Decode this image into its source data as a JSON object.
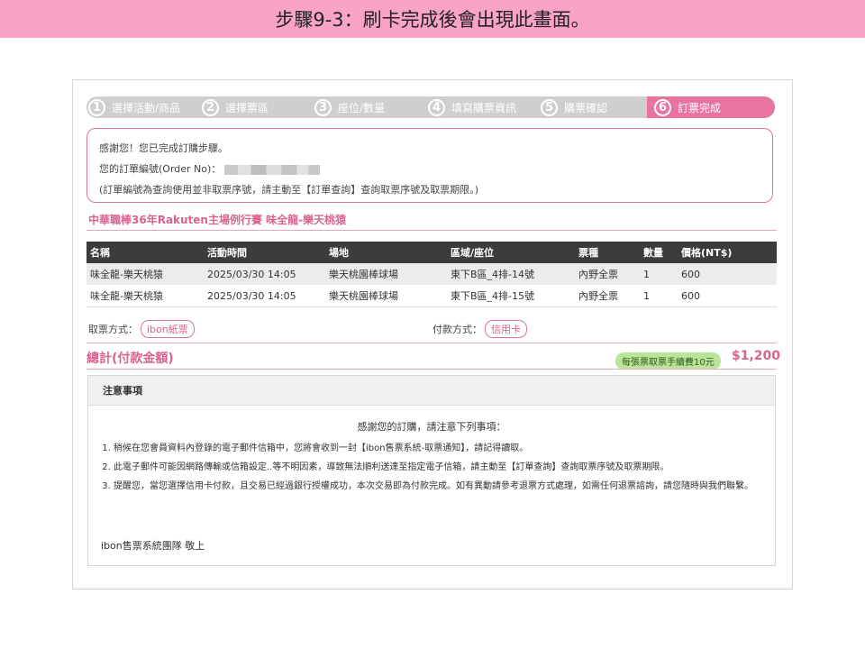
{
  "banner": {
    "title": "步驟9-3：刷卡完成後會出現此畫面。"
  },
  "steps": [
    {
      "num": "1",
      "label": "選擇活動/商品"
    },
    {
      "num": "2",
      "label": "選擇票區"
    },
    {
      "num": "3",
      "label": "座位/數量"
    },
    {
      "num": "4",
      "label": "填寫購票資訊"
    },
    {
      "num": "5",
      "label": "購票確認"
    },
    {
      "num": "6",
      "label": "訂票完成"
    }
  ],
  "confirmation": {
    "line1": "感謝您！您已完成訂購步驟。",
    "order_label": "您的訂單編號(Order  No)：",
    "note": "(訂單編號為查詢使用並非取票序號，請主動至【訂單查詢】查詢取票序號及取票期限。)"
  },
  "event": {
    "title": "中華職棒36年Rakuten主場例行賽  味全龍-樂天桃猿"
  },
  "table": {
    "headers": [
      "名稱",
      "活動時間",
      "場地",
      "區域/座位",
      "票種",
      "數量",
      "價格(NT$)"
    ],
    "rows": [
      [
        "味全龍-樂天桃猿",
        "2025/03/30  14:05",
        "樂天桃園棒球場",
        "東下B區_4排-14號",
        "內野全票",
        "1",
        "600"
      ],
      [
        "味全龍-樂天桃猿",
        "2025/03/30  14:05",
        "樂天桃園棒球場",
        "東下B區_4排-15號",
        "內野全票",
        "1",
        "600"
      ]
    ]
  },
  "pickup": {
    "label": "取票方式：",
    "value": "ibon紙票"
  },
  "payment": {
    "label": "付款方式：",
    "value": "信用卡"
  },
  "total": {
    "label": "總計(付款金額)",
    "fee_note": "每張票取票手續費10元",
    "amount": "$1,200"
  },
  "notice": {
    "heading": "注意事項",
    "intro": "感謝您的訂購，請注意下列事項：",
    "items": [
      "稍候在您會員資料內登錄的電子郵件信箱中，您將會收到一封【ibon售票系統-取票通知】，請記得讀取。",
      "此電子郵件可能因網路傳輸或信箱設定..等不明因素，導致無法順利送達至指定電子信箱，請主動至【訂單查詢】查詢取票序號及取票期限。",
      "提醒您，當您選擇信用卡付款，且交易已經過銀行授權成功，本次交易即為付款完成。如有異動請參考退票方式處理，如需任何退票諮詢，請您隨時與我們聯繫。"
    ],
    "signature": "ibon售票系統團隊  敬上"
  },
  "colors": {
    "accent": "#e8749f",
    "banner": "#f9a4c6",
    "step_inactive": "#cfcfcf",
    "fee_badge": "#b9e59a",
    "table_header": "#3c3c3c"
  }
}
